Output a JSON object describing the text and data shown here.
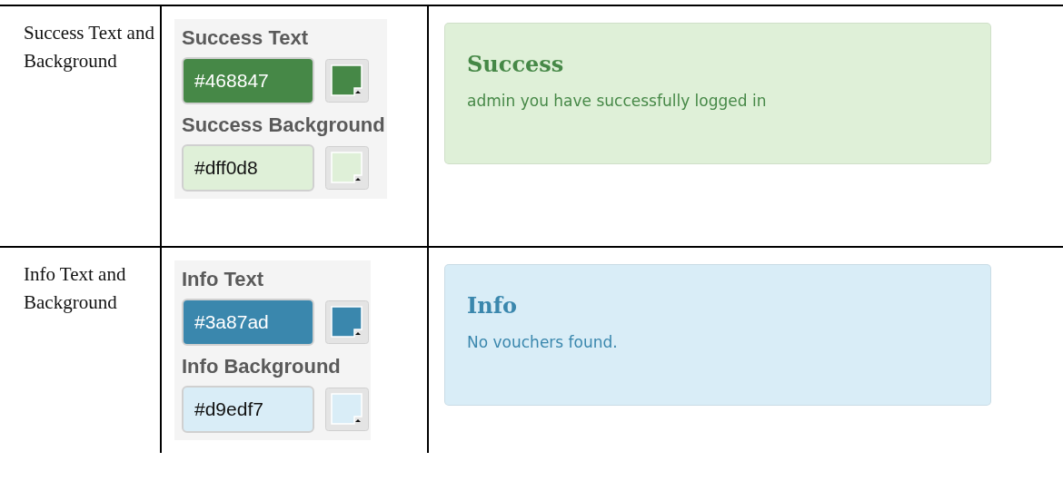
{
  "rows": [
    {
      "label": "Success Text and Background",
      "fields": [
        {
          "label": "Success Text",
          "kind": "text",
          "value": "#468847",
          "color": "#468847"
        },
        {
          "label": "Success Background",
          "kind": "background",
          "value": "#dff0d8",
          "color": "#dff0d8"
        }
      ],
      "alert": {
        "title": "Success",
        "message": "admin you have successfully logged in"
      }
    },
    {
      "label": "Info Text and Background",
      "fields": [
        {
          "label": "Info Text",
          "kind": "text",
          "value": "#3a87ad",
          "color": "#3a87ad"
        },
        {
          "label": "Info Background",
          "kind": "background",
          "value": "#d9edf7",
          "color": "#d9edf7"
        }
      ],
      "alert": {
        "title": "Info",
        "message": "No vouchers found."
      }
    }
  ]
}
